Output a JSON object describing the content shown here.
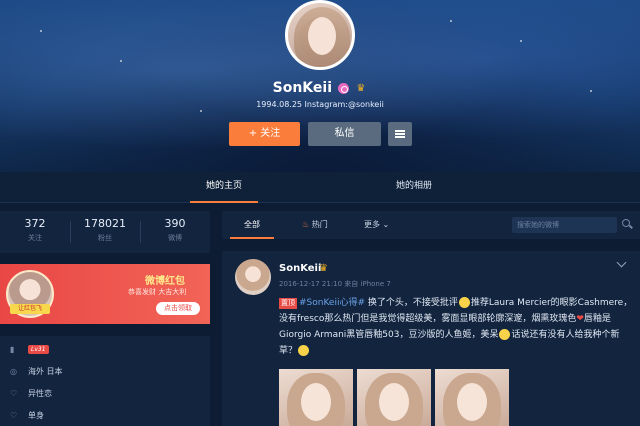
{
  "profile": {
    "name": "SonKeii",
    "bio": "1994.08.25 Instagram:@sonkeii",
    "follow_label": "+ 关注",
    "message_label": "私信"
  },
  "tabs": [
    {
      "label": "她的主页",
      "active": true
    },
    {
      "label": "她的相册",
      "active": false
    }
  ],
  "stats": [
    {
      "value": "372",
      "label": "关注"
    },
    {
      "value": "178021",
      "label": "粉丝"
    },
    {
      "value": "390",
      "label": "微博"
    }
  ],
  "promo": {
    "title": "微博红包",
    "subtitle": "恭喜发财 大吉大利",
    "button": "点击领取",
    "avatar_tag": "让红包飞"
  },
  "info": [
    {
      "icon": "level-icon",
      "text": "",
      "badge": "Lv31"
    },
    {
      "icon": "location-icon",
      "text": "海外 日本"
    },
    {
      "icon": "orientation-icon",
      "text": "异性恋"
    },
    {
      "icon": "relationship-icon",
      "text": "单身"
    }
  ],
  "feed": {
    "tabs": [
      "全部",
      "热门",
      "更多"
    ],
    "search_placeholder": "搜索她的微博"
  },
  "post": {
    "author": "SonKeii",
    "meta": "2016-12-17 21:10 来自 iPhone 7",
    "top_tag": "置顶",
    "hashtag": "#SonKeii心得#",
    "text_1": " 换了个头，不接受批评",
    "text_2": "推荐Laura Mercier的眼影Cashmere，没有fresco那么热门但是我觉得超级美，雾面显眼部轮廓深邃，烟熏玫瑰色",
    "text_3": "唇釉是Giorgio Armani黑管唇釉503，豆沙版的人鱼姬，美呆",
    "text_4": "话说还有没有人给我种个新草？"
  },
  "colors": {
    "accent": "#fa7d3c",
    "background": "#0d1c33",
    "panel": "#12243e",
    "link": "#6aa2e8"
  }
}
